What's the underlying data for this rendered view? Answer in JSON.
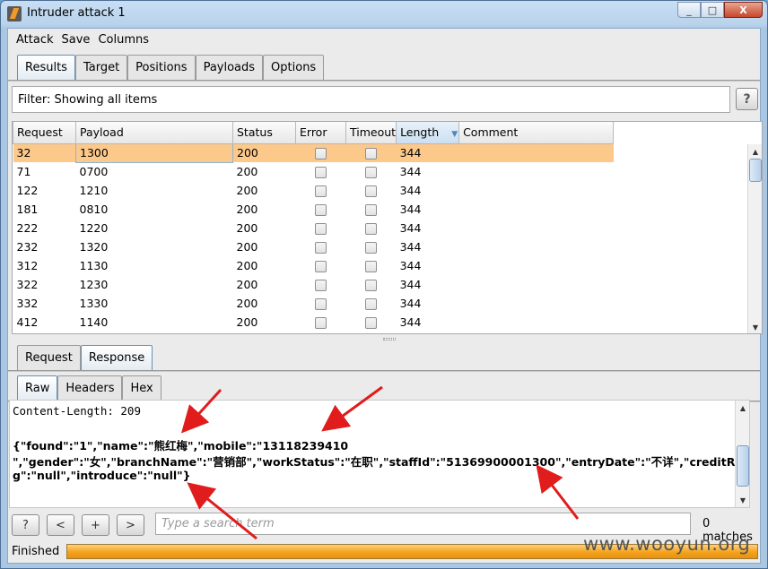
{
  "window": {
    "title": "Intruder attack 1",
    "controls": [
      "_",
      "□",
      "X"
    ]
  },
  "menu": [
    "Attack",
    "Save",
    "Columns"
  ],
  "main_tabs": [
    "Results",
    "Target",
    "Positions",
    "Payloads",
    "Options"
  ],
  "filter": {
    "text": "Filter: Showing all items",
    "help": "?"
  },
  "table": {
    "columns": [
      "Request",
      "Payload",
      "Status",
      "Error",
      "Timeout",
      "Length",
      "Comment"
    ],
    "sorted_column": "Length",
    "rows": [
      {
        "request": "32",
        "payload": "1300",
        "status": "200",
        "length": "344",
        "selected": true
      },
      {
        "request": "71",
        "payload": "0700",
        "status": "200",
        "length": "344"
      },
      {
        "request": "122",
        "payload": "1210",
        "status": "200",
        "length": "344"
      },
      {
        "request": "181",
        "payload": "0810",
        "status": "200",
        "length": "344"
      },
      {
        "request": "222",
        "payload": "1220",
        "status": "200",
        "length": "344"
      },
      {
        "request": "232",
        "payload": "1320",
        "status": "200",
        "length": "344"
      },
      {
        "request": "312",
        "payload": "1130",
        "status": "200",
        "length": "344"
      },
      {
        "request": "322",
        "payload": "1230",
        "status": "200",
        "length": "344"
      },
      {
        "request": "332",
        "payload": "1330",
        "status": "200",
        "length": "344"
      },
      {
        "request": "412",
        "payload": "1140",
        "status": "200",
        "length": "344"
      }
    ]
  },
  "detail_tabs": [
    "Request",
    "Response"
  ],
  "view_tabs": [
    "Raw",
    "Headers",
    "Hex"
  ],
  "response": {
    "line1": "Content-Length: 209",
    "line2": "{\"found\":\"1\",\"name\":\"熊红梅\",\"mobile\":\"13118239410",
    "line3": "\",\"gender\":\"女\",\"branchName\":\"营销部\",\"workStatus\":\"在职\",\"staffId\":\"51369900001300\",\"entryDate\":\"不详\",\"creditRatin",
    "line4": "g\":\"null\",\"introduce\":\"null\"}"
  },
  "search": {
    "buttons": [
      "?",
      "<",
      "+",
      ">"
    ],
    "placeholder": "Type a search term",
    "matches": "0 matches"
  },
  "status": {
    "text": "Finished",
    "progress": 1.0
  },
  "watermark": "www.wooyun.org",
  "colors": {
    "selected_row": "#fdc98a",
    "progress": "#f4a21c",
    "arrow": "#e01c1c"
  }
}
